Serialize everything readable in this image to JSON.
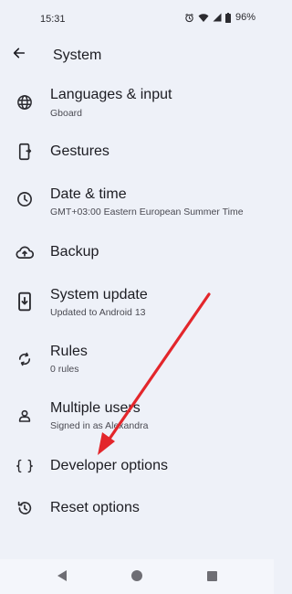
{
  "status_bar": {
    "time": "15:31",
    "battery_percent": "96%",
    "icons": [
      "alarm-icon",
      "wifi-icon",
      "signal-icon",
      "battery-icon"
    ]
  },
  "app_bar": {
    "title": "System",
    "back_icon": "arrow-left-icon"
  },
  "items": [
    {
      "title": "Languages & input",
      "summary": "Gboard",
      "icon": "globe-icon"
    },
    {
      "title": "Gestures",
      "summary": "",
      "icon": "phone-gesture-icon"
    },
    {
      "title": "Date & time",
      "summary": "GMT+03:00 Eastern European Summer Time",
      "icon": "clock-icon"
    },
    {
      "title": "Backup",
      "summary": "",
      "icon": "cloud-upload-icon"
    },
    {
      "title": "System update",
      "summary": "Updated to Android 13",
      "icon": "phone-update-icon"
    },
    {
      "title": "Rules",
      "summary": "0 rules",
      "icon": "sync-rules-icon"
    },
    {
      "title": "Multiple users",
      "summary": "Signed in as Alexandra",
      "icon": "person-icon"
    },
    {
      "title": "Developer options",
      "summary": "",
      "icon": "code-braces-icon"
    },
    {
      "title": "Reset options",
      "summary": "",
      "icon": "history-icon"
    }
  ],
  "nav_bar": {
    "buttons": [
      "back-triangle-icon",
      "home-circle-icon",
      "recents-square-icon"
    ]
  },
  "colors": {
    "background": "#eef1f8",
    "annotation_arrow": "#e3262b"
  }
}
